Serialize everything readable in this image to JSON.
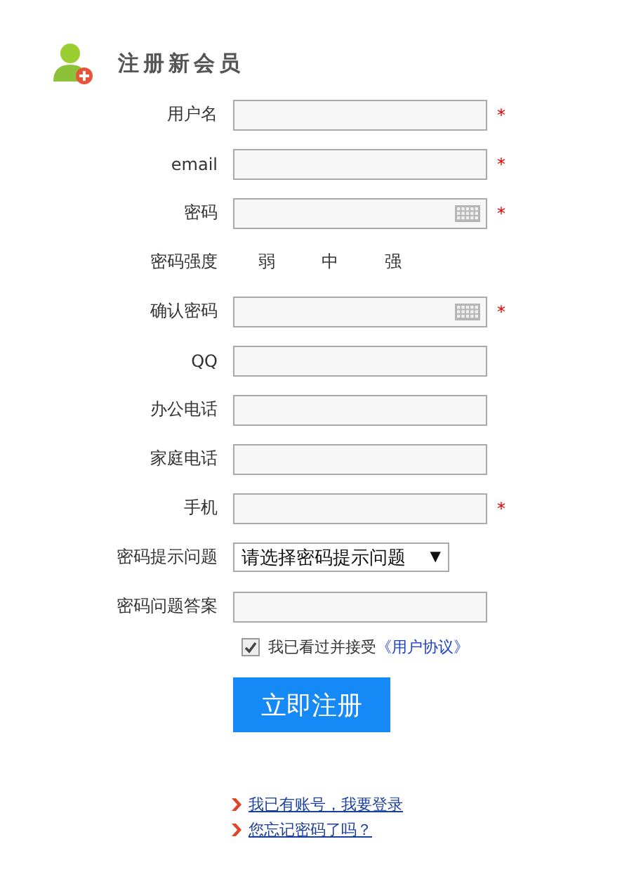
{
  "title": "注册新会员",
  "fields": [
    {
      "kind": "input",
      "label": "用户名",
      "required": true,
      "keyboard": false
    },
    {
      "kind": "input",
      "label": "email",
      "required": true,
      "keyboard": false
    },
    {
      "kind": "input",
      "label": "密码",
      "required": true,
      "keyboard": true
    },
    {
      "kind": "strength",
      "label": "密码强度",
      "levels": [
        "弱",
        "中",
        "强"
      ]
    },
    {
      "kind": "input",
      "label": "确认密码",
      "required": true,
      "keyboard": true
    },
    {
      "kind": "input",
      "label": "QQ",
      "required": false,
      "keyboard": false
    },
    {
      "kind": "input",
      "label": "办公电话",
      "required": false,
      "keyboard": false
    },
    {
      "kind": "input",
      "label": "家庭电话",
      "required": false,
      "keyboard": false
    },
    {
      "kind": "input",
      "label": "手机",
      "required": true,
      "keyboard": false
    },
    {
      "kind": "select",
      "label": "密码提示问题",
      "value": "请选择密码提示问题",
      "arrow": "▼"
    },
    {
      "kind": "input",
      "label": "密码问题答案",
      "required": false,
      "keyboard": false
    }
  ],
  "required_mark": "*",
  "agreement": {
    "checked": true,
    "text": "我已看过并接受",
    "link": "《用户协议》"
  },
  "submit": "立即注册",
  "links": [
    "我已有账号，我要登录",
    "您忘记密码了吗？"
  ]
}
